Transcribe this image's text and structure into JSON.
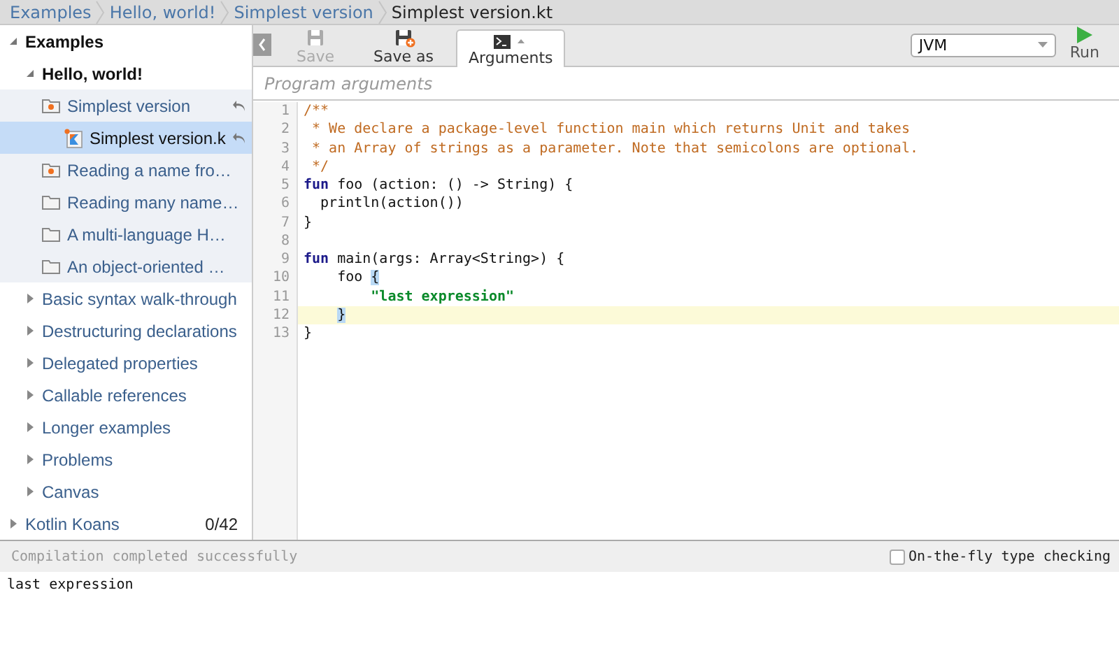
{
  "breadcrumb": [
    {
      "label": "Examples",
      "current": false
    },
    {
      "label": "Hello, world!",
      "current": false
    },
    {
      "label": "Simplest version",
      "current": false
    },
    {
      "label": "Simplest version.kt",
      "current": true
    }
  ],
  "tree": [
    {
      "label": "Examples",
      "kind": "group",
      "expanded": true,
      "selected": false,
      "children": [
        {
          "label": "Hello, world!",
          "kind": "group",
          "expanded": true,
          "selected": false,
          "children": [
            {
              "label": "Simplest version",
              "kind": "folder-done",
              "expanded": true,
              "selected": false,
              "revert": true,
              "children": [
                {
                  "label": "Simplest version.k",
                  "kind": "file",
                  "selected": true,
                  "revert": true
                }
              ]
            },
            {
              "label": "Reading a name fro…",
              "kind": "folder-done",
              "selected": false
            },
            {
              "label": "Reading many name…",
              "kind": "folder",
              "selected": false
            },
            {
              "label": "A multi-language H…",
              "kind": "folder",
              "selected": false
            },
            {
              "label": "An object-oriented …",
              "kind": "folder",
              "selected": false
            }
          ]
        },
        {
          "label": "Basic syntax walk-through",
          "kind": "section",
          "expanded": false,
          "selected": false
        },
        {
          "label": "Destructuring declarations",
          "kind": "section",
          "expanded": false,
          "selected": false
        },
        {
          "label": "Delegated properties",
          "kind": "section",
          "expanded": false,
          "selected": false
        },
        {
          "label": "Callable references",
          "kind": "section",
          "expanded": false,
          "selected": false
        },
        {
          "label": "Longer examples",
          "kind": "section",
          "expanded": false,
          "selected": false
        },
        {
          "label": "Problems",
          "kind": "section",
          "expanded": false,
          "selected": false
        },
        {
          "label": "Canvas",
          "kind": "section",
          "expanded": false,
          "selected": false
        }
      ]
    },
    {
      "label": "Kotlin Koans",
      "kind": "section",
      "expanded": false,
      "selected": false,
      "count": "0/42"
    }
  ],
  "toolbar": {
    "buttons": [
      {
        "label": "Save",
        "kind": "save",
        "disabled": true
      },
      {
        "label": "Save as",
        "kind": "save-as",
        "disabled": false
      }
    ],
    "tab": {
      "label": "Arguments",
      "selected": true
    },
    "target": "JVM",
    "run": "Run"
  },
  "arguments": {
    "placeholder": "Program arguments"
  },
  "code": [
    {
      "number": "1",
      "current": false,
      "tokens": [
        {
          "kind": "comment",
          "text": "/**"
        }
      ]
    },
    {
      "number": "2",
      "current": false,
      "tokens": [
        {
          "kind": "comment",
          "text": " * We declare a package-level function main which returns Unit and takes"
        }
      ]
    },
    {
      "number": "3",
      "current": false,
      "tokens": [
        {
          "kind": "comment",
          "text": " * an Array of strings as a parameter. Note that semicolons are optional."
        }
      ]
    },
    {
      "number": "4",
      "current": false,
      "tokens": [
        {
          "kind": "comment",
          "text": " */"
        }
      ]
    },
    {
      "number": "5",
      "current": false,
      "tokens": [
        {
          "kind": "keyword",
          "text": "fun"
        },
        {
          "kind": "plain",
          "text": " foo (action: () -> String) {"
        }
      ]
    },
    {
      "number": "6",
      "current": false,
      "tokens": [
        {
          "kind": "plain",
          "text": "  println(action())"
        }
      ]
    },
    {
      "number": "7",
      "current": false,
      "tokens": [
        {
          "kind": "plain",
          "text": "}"
        }
      ]
    },
    {
      "number": "8",
      "current": false
    },
    {
      "number": "9",
      "current": false,
      "tokens": [
        {
          "kind": "keyword",
          "text": "fun"
        },
        {
          "kind": "plain",
          "text": " main(args: Array<String>) {"
        }
      ]
    },
    {
      "number": "10",
      "current": false,
      "tokens": [
        {
          "kind": "plain",
          "text": "    foo "
        },
        {
          "kind": "brace",
          "text": "{"
        }
      ]
    },
    {
      "number": "11",
      "current": false,
      "tokens": [
        {
          "kind": "string",
          "text": "        \"last expression\""
        }
      ]
    },
    {
      "number": "12",
      "current": true,
      "tokens": [
        {
          "kind": "brace",
          "text": "    }"
        }
      ]
    },
    {
      "number": "13",
      "current": false,
      "tokens": [
        {
          "kind": "plain",
          "text": "}"
        }
      ]
    }
  ],
  "status": {
    "message": "Compilation completed successfully",
    "option": {
      "label": "On-the-fly type checking",
      "checked": false
    }
  },
  "output": "last expression"
}
